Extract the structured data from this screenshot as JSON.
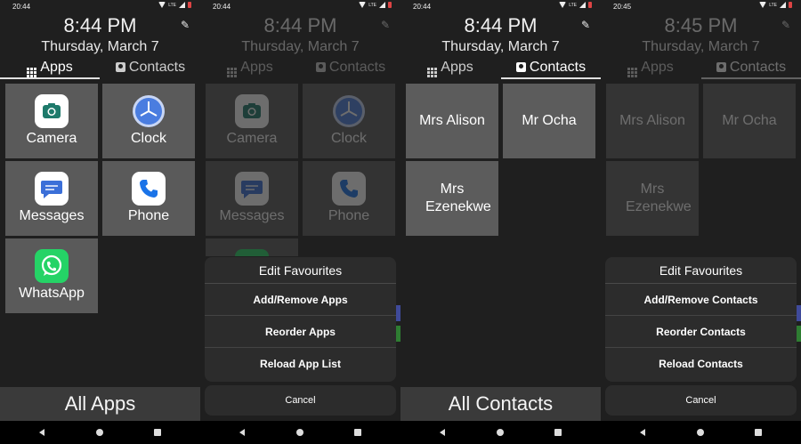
{
  "screens": [
    {
      "status_time": "20:44",
      "clock": "8:44 PM",
      "date": "Thursday, March 7",
      "tabs": {
        "apps": "Apps",
        "contacts": "Contacts",
        "active": "apps"
      },
      "apps": [
        {
          "label": "Camera",
          "icon": "camera-icon"
        },
        {
          "label": "Clock",
          "icon": "clock-icon"
        },
        {
          "label": "Messages",
          "icon": "messages-icon"
        },
        {
          "label": "Phone",
          "icon": "phone-icon"
        },
        {
          "label": "WhatsApp",
          "icon": "whatsapp-icon"
        }
      ],
      "bottom_label": "All Apps"
    },
    {
      "status_time": "20:44",
      "clock": "8:44 PM",
      "date": "Thursday, March 7",
      "tabs": {
        "apps": "Apps",
        "contacts": "Contacts",
        "active": "apps"
      },
      "apps": [
        {
          "label": "Camera",
          "icon": "camera-icon"
        },
        {
          "label": "Clock",
          "icon": "clock-icon"
        },
        {
          "label": "Messages",
          "icon": "messages-icon"
        },
        {
          "label": "Phone",
          "icon": "phone-icon"
        }
      ],
      "sheet": {
        "title": "Edit Favourites",
        "items": [
          "Add/Remove Apps",
          "Reorder Apps",
          "Reload App List"
        ],
        "cancel": "Cancel"
      }
    },
    {
      "status_time": "20:44",
      "clock": "8:44 PM",
      "date": "Thursday, March 7",
      "tabs": {
        "apps": "Apps",
        "contacts": "Contacts",
        "active": "contacts"
      },
      "contacts": [
        "Mrs Alison",
        "Mr Ocha",
        "Mrs Ezenekwe"
      ],
      "bottom_label": "All Contacts"
    },
    {
      "status_time": "20:45",
      "clock": "8:45 PM",
      "date": "Thursday, March 7",
      "tabs": {
        "apps": "Apps",
        "contacts": "Contacts",
        "active": "contacts"
      },
      "contacts": [
        "Mrs Alison",
        "Mr Ocha",
        "Mrs Ezenekwe"
      ],
      "sheet": {
        "title": "Edit Favourites",
        "items": [
          "Add/Remove Contacts",
          "Reorder Contacts",
          "Reload Contacts"
        ],
        "cancel": "Cancel"
      }
    }
  ],
  "colors": {
    "background": "#1f1f1f",
    "tile": "#5a5a5a",
    "sheet": "#2c2c2c",
    "bottom_bar": "#3a3a3a",
    "clock_blue": "#4a7de0",
    "messages_blue": "#3b6fd8",
    "phone_blue": "#1a73e8",
    "whatsapp_green": "#25d366",
    "edge_blue": "#3f4a9a",
    "edge_green": "#2e7d32"
  }
}
